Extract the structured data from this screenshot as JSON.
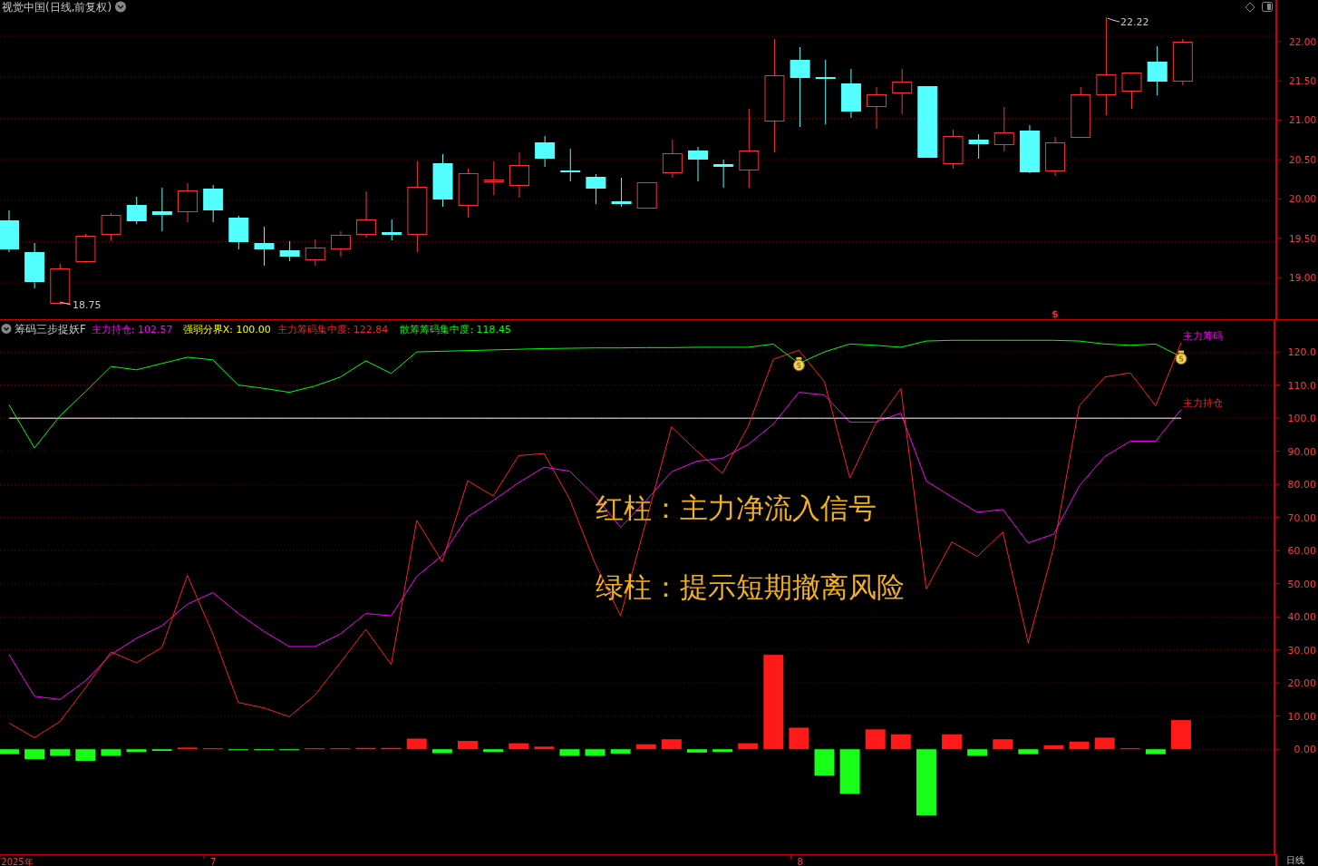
{
  "price_panel": {
    "title": "视觉中国(日线,前复权)",
    "axis_labels": [
      "22.00",
      "21.50",
      "21.00",
      "20.50",
      "20.00",
      "19.50",
      "19.00"
    ],
    "high_label": "22.22",
    "low_label": "18.75",
    "marker": "$"
  },
  "indicator_panel": {
    "name": "筹码三步捉妖F",
    "legend": [
      {
        "text": "主力持仓: 102.57",
        "color": "#ff00ff"
      },
      {
        "text": "强弱分界X: 100.00",
        "color": "#ffff00"
      },
      {
        "text": "主力筹码集中度: 122.84",
        "color": "#ff2020"
      },
      {
        "text": "散筹筹码集中度: 118.45",
        "color": "#00ff00"
      }
    ],
    "chart_data": {
      "type": "line",
      "grid": true,
      "categories": [
        "2025年",
        null,
        null,
        null,
        null,
        null,
        null,
        null,
        "7",
        null,
        null,
        null,
        null,
        null,
        null,
        null,
        null,
        null,
        null,
        null,
        null,
        null,
        null,
        null,
        null,
        null,
        null,
        null,
        null,
        null,
        null,
        "8",
        null,
        null,
        null,
        null,
        null,
        null,
        null,
        null,
        null,
        null,
        null,
        null,
        null,
        null,
        null
      ],
      "ylim": [
        -31.6,
        129.5
      ],
      "yticks": [
        {
          "value": 120,
          "label": "120.0"
        },
        {
          "value": 110,
          "label": "110.0"
        },
        {
          "value": 100,
          "label": "100.0"
        },
        {
          "value": 90,
          "label": "90.00"
        },
        {
          "value": 80,
          "label": "80.00"
        },
        {
          "value": 70,
          "label": "70.00"
        },
        {
          "value": 60,
          "label": "60.00"
        },
        {
          "value": 50,
          "label": "50.00"
        },
        {
          "value": 40,
          "label": "40.00"
        },
        {
          "value": 30,
          "label": "30.00"
        },
        {
          "value": 20,
          "label": "20.00"
        },
        {
          "value": 10,
          "label": "10.00"
        },
        {
          "value": 0,
          "label": "0.00"
        }
      ],
      "series": [
        {
          "color": "#ff00ff",
          "values": [
            28.6,
            16,
            15,
            20.7,
            28.6,
            33.5,
            37.3,
            43.8,
            47.3,
            41,
            35.6,
            31,
            31,
            34.8,
            41,
            40.3,
            52.2,
            58.5,
            70.2,
            75.1,
            80.5,
            85.2,
            84,
            76.5,
            67,
            75.1,
            83.8,
            87,
            87.9,
            92,
            98.2,
            107.8,
            107,
            98.8,
            98.8,
            101.5,
            81,
            76.2,
            71.6,
            72.4,
            62.3,
            65,
            79.5,
            88.4,
            93,
            93,
            102.6
          ]
        },
        {
          "color": "#ffffff",
          "values": [
            100,
            100,
            100,
            100,
            100,
            100,
            100,
            100,
            100,
            100,
            100,
            100,
            100,
            100,
            100,
            100,
            100,
            100,
            100,
            100,
            100,
            100,
            100,
            100,
            100,
            100,
            100,
            100,
            100,
            100,
            100,
            100,
            100,
            100,
            100,
            100,
            100,
            100,
            100,
            100,
            100,
            100,
            100,
            100,
            100,
            100,
            100
          ]
        },
        {
          "color": "#ff2020",
          "values": [
            7.9,
            3.5,
            8.4,
            18.5,
            29.4,
            26.1,
            30.7,
            52.5,
            34.8,
            14.1,
            12.5,
            9.8,
            16.3,
            26.1,
            36.2,
            25.6,
            69.1,
            56.6,
            81.1,
            76.5,
            88.7,
            89.3,
            75.6,
            56.1,
            40.3,
            68.8,
            97.4,
            90,
            83.3,
            97.4,
            117.8,
            120.5,
            111,
            81.9,
            98.2,
            109,
            48.4,
            62.6,
            58.2,
            65.6,
            32.1,
            61,
            103.7,
            112.4,
            113.7,
            103.7,
            122.8
          ]
        },
        {
          "color": "#00ff00",
          "values": [
            104,
            91,
            100.7,
            108,
            115.6,
            114.6,
            116.5,
            118.4,
            117.6,
            110,
            109,
            107.8,
            109.7,
            112.4,
            117.3,
            113.5,
            120,
            120.2,
            120.4,
            120.6,
            120.8,
            121,
            121.1,
            121.2,
            121.2,
            121.3,
            121.3,
            121.4,
            121.4,
            121.4,
            122.4,
            116.5,
            120,
            122.4,
            122,
            121.4,
            123.3,
            123.5,
            123.5,
            123.5,
            123.5,
            123.5,
            123.3,
            122.4,
            122,
            122.4,
            118.5
          ]
        },
        {
          "type": "bar",
          "colors": [
            "#18ff18",
            "#18ff18",
            "#18ff18",
            "#18ff18",
            "#18ff18",
            "#18ff18",
            "#18ff18",
            "#ff1a1a",
            "#ff1a1a",
            "#18ff18",
            "#18ff18",
            "#18ff18",
            "#ff1a1a",
            "#ff1a1a",
            "#ff1a1a",
            "#ff1a1a",
            "#ff1a1a",
            "#18ff18",
            "#ff1a1a",
            "#18ff18",
            "#ff1a1a",
            "#ff1a1a",
            "#18ff18",
            "#18ff18",
            "#18ff18",
            "#ff1a1a",
            "#ff1a1a",
            "#18ff18",
            "#18ff18",
            "#ff1a1a",
            "#ff1a1a",
            "#ff1a1a",
            "#18ff18",
            "#18ff18",
            "#ff1a1a",
            "#ff1a1a",
            "#18ff18",
            "#ff1a1a",
            "#18ff18",
            "#ff1a1a",
            "#18ff18",
            "#ff1a1a",
            "#ff1a1a",
            "#ff1a1a",
            "#ff1a1a",
            "#18ff18",
            "#ff1a1a"
          ],
          "values": [
            -1.5,
            -3,
            -2,
            -3.5,
            -2,
            -0.8,
            -0.5,
            0.5,
            0.3,
            -0.3,
            -0.3,
            -0.3,
            0.3,
            0.3,
            0.4,
            0.4,
            3.2,
            -1.2,
            2.5,
            -0.8,
            1.8,
            0.8,
            -2,
            -2,
            -1.3,
            1.5,
            3,
            -1,
            -0.8,
            1.8,
            28.5,
            6.5,
            -8,
            -13.5,
            6,
            4.5,
            -20,
            4.5,
            -2,
            3,
            -1.5,
            1.2,
            2.3,
            3.5,
            0.3,
            -1.5,
            8.8
          ]
        }
      ],
      "annotations": [
        "红柱：主力净流入信号",
        "绿柱：提示短期撤离风险",
        "主力筹码",
        "主力持仓"
      ]
    }
  },
  "period_label": "日线"
}
